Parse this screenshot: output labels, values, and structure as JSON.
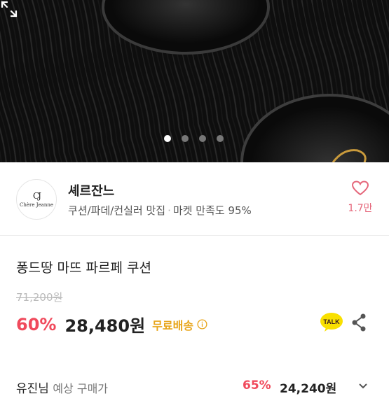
{
  "hero": {
    "slide_count": 4,
    "active_slide": 1
  },
  "shop": {
    "logo_mark": "CJ",
    "logo_text": "Chère Jeanne",
    "name": "셰르잔느",
    "tagline": "쿠션/파데/컨실러 맛집",
    "separator": "·",
    "satisfaction": "마켓 만족도 95%",
    "likes": "1.7만"
  },
  "product": {
    "title": "퐁드땅 마뜨 파르페 쿠션",
    "original_price": "71,200원",
    "discount": "60%",
    "price": "28,480원",
    "shipping": "무료배송"
  },
  "next_row": {
    "name": "유진님",
    "label": "예상 구매가",
    "discount": "65%",
    "price": "24,240원"
  },
  "colors": {
    "accent": "#f04a5c",
    "shipping": "#e8a51a",
    "kakao": "#f9e000"
  }
}
